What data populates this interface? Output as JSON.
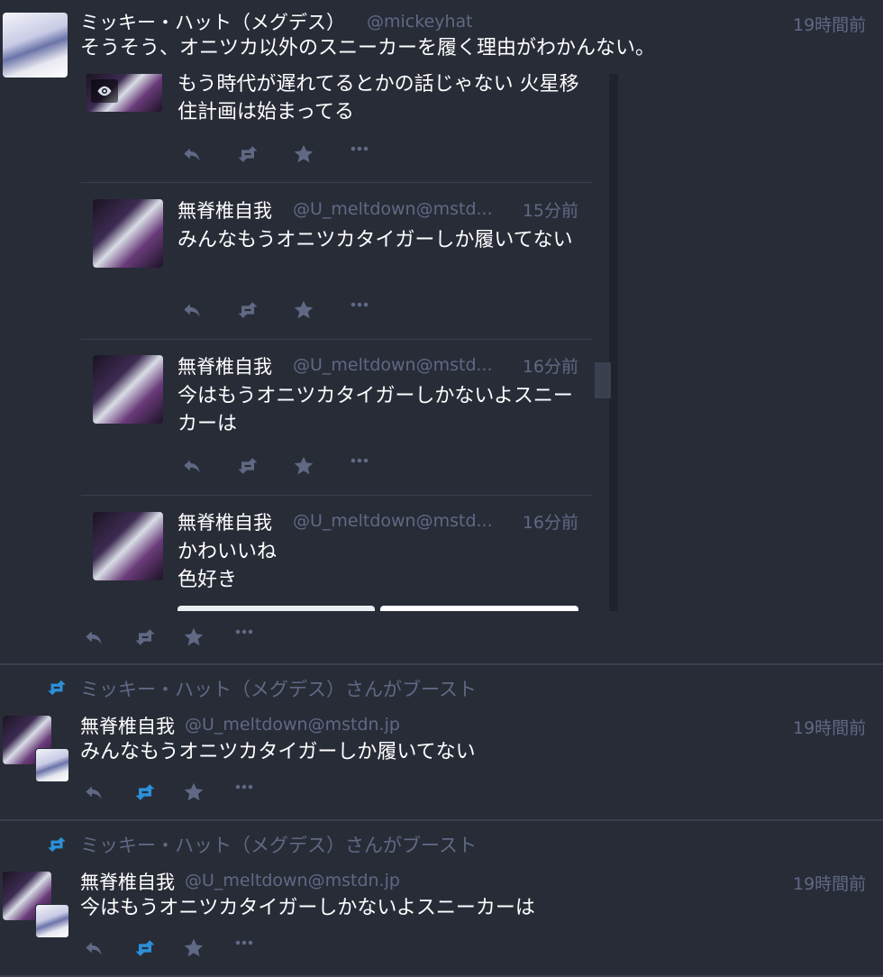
{
  "main_status": {
    "display_name": "ミッキー・ハット（メグデス）",
    "handle": "@mickeyhat",
    "time": "19時間前",
    "content": "そうそう、オニツカ以外のスニーカーを履く理由がわかんない。"
  },
  "thread": {
    "partial_top_content": "もう時代が遅れてるとかの話じゃない 火星移住計画は始まってる",
    "replies": [
      {
        "display_name": "無脊椎自我",
        "handle": "@U_meltdown@mstd...",
        "time": "15分前",
        "content": "みんなもうオニツカタイガーしか履いてない"
      },
      {
        "display_name": "無脊椎自我",
        "handle": "@U_meltdown@mstd...",
        "time": "16分前",
        "content": "今はもうオニツカタイガーしかないよスニーカーは"
      },
      {
        "display_name": "無脊椎自我",
        "handle": "@U_meltdown@mstd...",
        "time": "16分前",
        "content_line1": "かわいいね",
        "content_line2": "色好き"
      }
    ]
  },
  "boosts": [
    {
      "boosted_by": "ミッキー・ハットさんがブースト",
      "boosted_by_full": "ミッキー・ハット（メグデス）さんがブースト",
      "display_name": "無脊椎自我",
      "handle": "@U_meltdown@mstdn.jp",
      "time": "19時間前",
      "content": "みんなもうオニツカタイガーしか履いてない",
      "reblogged": true
    },
    {
      "boosted_by_full": "ミッキー・ハット（メグデス）さんがブースト",
      "display_name": "無脊椎自我",
      "handle": "@U_meltdown@mstdn.jp",
      "time": "19時間前",
      "content": "今はもうオニツカタイガーしかないよスニーカーは",
      "reblogged": true
    }
  ],
  "icons": [
    "reply-icon",
    "boost-icon",
    "favourite-icon",
    "more-icon",
    "eye-icon"
  ],
  "colors": {
    "background": "#282c37",
    "text_primary": "#ffffff",
    "text_secondary": "#606984",
    "boost_active": "#2b90d9",
    "divider": "#393f4f"
  }
}
